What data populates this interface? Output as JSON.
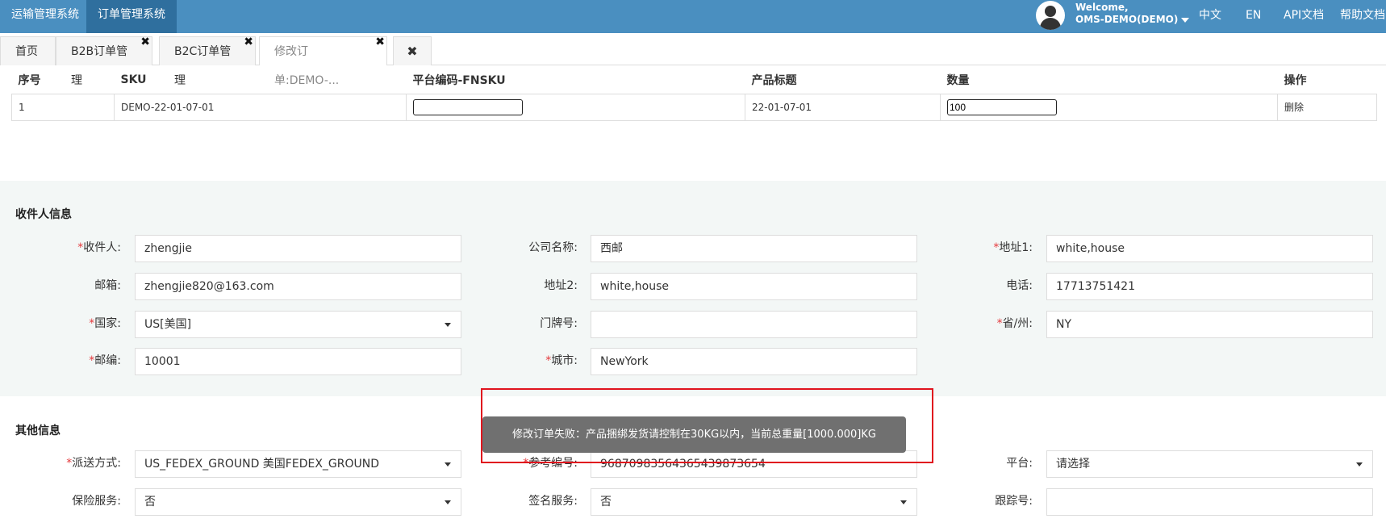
{
  "topbar": {
    "systems": [
      "运输管理系统",
      "订单管理系统"
    ],
    "welcome_line1": "Welcome,",
    "welcome_line2": "OMS-DEMO(DEMO)",
    "links": [
      "中文",
      "EN",
      "API文档",
      "帮助文档"
    ]
  },
  "tabs": [
    {
      "label": "首页",
      "closable": false
    },
    {
      "label": "B2B订单管理",
      "closable": true
    },
    {
      "label": "B2C订单管理",
      "closable": true
    },
    {
      "label": "修改订单:DEMO-...",
      "closable": true,
      "active": true
    }
  ],
  "table": {
    "headers": [
      "序号",
      "SKU",
      "平台编码-FNSKU",
      "产品标题",
      "数量",
      "操作"
    ],
    "rows": [
      {
        "index": "1",
        "sku": "DEMO-22-01-07-01",
        "fnsku": "",
        "title": "22-01-07-01",
        "qty": "100",
        "action": "删除"
      }
    ]
  },
  "recipient": {
    "title": "收件人信息",
    "fields": {
      "name": {
        "label": "收件人:",
        "value": "zhengjie",
        "required": true
      },
      "company": {
        "label": "公司名称:",
        "value": "西邮",
        "required": false
      },
      "address1": {
        "label": "地址1:",
        "value": "white,house",
        "required": true
      },
      "email": {
        "label": "邮箱:",
        "value": "zhengjie820@163.com",
        "required": false
      },
      "address2": {
        "label": "地址2:",
        "value": "white,house",
        "required": false
      },
      "phone": {
        "label": "电话:",
        "value": "17713751421",
        "required": false
      },
      "country": {
        "label": "国家:",
        "value": "US[美国]",
        "required": true
      },
      "door": {
        "label": "门牌号:",
        "value": "",
        "required": false
      },
      "state": {
        "label": "省/州:",
        "value": "NY",
        "required": true
      },
      "zip": {
        "label": "邮编:",
        "value": "10001",
        "required": true
      },
      "city": {
        "label": "城市:",
        "value": "NewYork",
        "required": true
      }
    }
  },
  "other": {
    "title": "其他信息",
    "fields": {
      "shipping": {
        "label": "派送方式:",
        "value": "US_FEDEX_GROUND 美国FEDEX_GROUND",
        "required": true
      },
      "reference": {
        "label": "参考编号:",
        "value": "96870983564365439873654",
        "required": true
      },
      "platform": {
        "label": "平台:",
        "value": "请选择",
        "required": false
      },
      "insurance": {
        "label": "保险服务:",
        "value": "否",
        "required": false
      },
      "signature": {
        "label": "签名服务:",
        "value": "否",
        "required": false
      },
      "tracking": {
        "label": "跟踪号:",
        "value": "",
        "required": false
      }
    }
  },
  "toast": {
    "message": "修改订单失败：产品捆绑发货请控制在30KG以内，当前总重量[1000.000]KG"
  },
  "colors": {
    "topbar": "#4a8fc0",
    "topbar_active": "#2f6f9e",
    "required": "#e4393c",
    "highlight": "#e0141e",
    "toast_bg": "#707070"
  }
}
